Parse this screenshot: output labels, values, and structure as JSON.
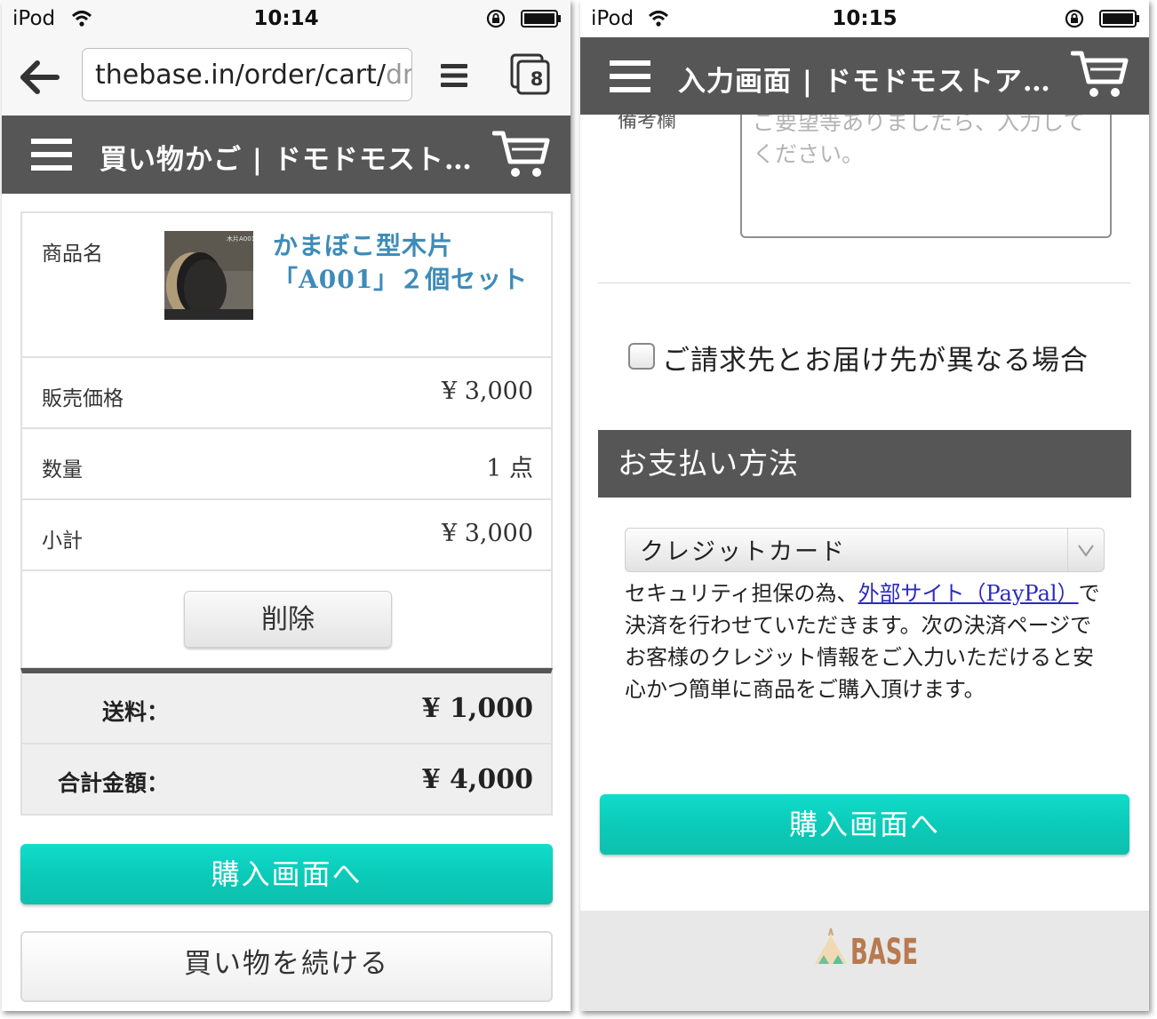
{
  "left": {
    "status": {
      "carrier": "iPod",
      "time": "10:14"
    },
    "browser": {
      "url_main": "thebase.in/order/cart/",
      "url_faded": "dn",
      "tab_count": "8"
    },
    "nav": {
      "title": "買い物かご | ドモドモスト…"
    },
    "cart": {
      "product_label": "商品名",
      "product_name": "かまぼこ型木片「A001」２個セット",
      "thumb_caption": "木片A001 2個セット",
      "price_label": "販売価格",
      "price_value": "¥ 3,000",
      "qty_label": "数量",
      "qty_value": "1 点",
      "subtotal_label": "小計",
      "subtotal_value": "¥  3,000",
      "delete_label": "削除"
    },
    "summary": {
      "shipping_label": "送料：",
      "shipping_value": "¥ 1,000",
      "total_label": "合計金額：",
      "total_value": "¥ 4,000"
    },
    "buttons": {
      "purchase": "購入画面へ",
      "continue": "買い物を続ける"
    }
  },
  "right": {
    "status": {
      "carrier": "iPod",
      "time": "10:15"
    },
    "nav": {
      "title": "入力画面 | ドモドモストア…"
    },
    "remarks": {
      "label": "備考欄",
      "placeholder": "ご要望等ありましたら、入力してください。"
    },
    "checkbox_label": "ご請求先とお届け先が異なる場合",
    "payment": {
      "heading": "お支払い方法",
      "selected": "クレジットカード",
      "note_pre": "セキュリティ担保の為、",
      "note_link": "外部サイト（PayPal）",
      "note_post": "で決済を行わせていただきます。次の決済ページでお客様のクレジット情報をご入力いただけると安心かつ簡単に商品をご購入頂けます。"
    },
    "buttons": {
      "purchase": "購入画面へ"
    },
    "footer": {
      "logo": "BASE"
    }
  },
  "colors": {
    "nav_bg": "#565656",
    "accent_teal": "#0bcbb9",
    "link_blue": "#3d8bb8"
  }
}
